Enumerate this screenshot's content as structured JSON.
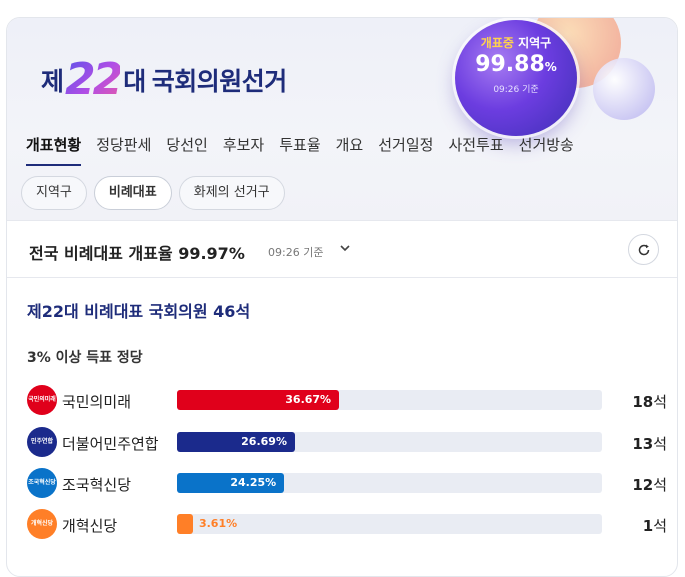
{
  "header": {
    "logo": {
      "prefix": "제",
      "number": "22",
      "suffix_dae": "대",
      "title": "국회의원선거"
    },
    "orb": {
      "label_a": "개표중",
      "label_b": "지역구",
      "percent": "99.88",
      "percent_unit": "%",
      "time": "09:26 기준"
    }
  },
  "tabs": [
    {
      "label": "개표현황",
      "active": true
    },
    {
      "label": "정당판세"
    },
    {
      "label": "당선인"
    },
    {
      "label": "후보자"
    },
    {
      "label": "투표율"
    },
    {
      "label": "개요"
    },
    {
      "label": "선거일정"
    },
    {
      "label": "사전투표"
    },
    {
      "label": "선거방송"
    }
  ],
  "pills": [
    {
      "label": "지역구"
    },
    {
      "label": "비례대표",
      "active": true
    },
    {
      "label": "화제의 선거구"
    }
  ],
  "status": {
    "text": "전국 비례대표 개표율",
    "percent": "99.97",
    "unit": "%",
    "time": "09:26 기준",
    "refresh_icon": "refresh-icon"
  },
  "main": {
    "title": "제22대 비례대표 국회의원 46석",
    "subtitle": "3% 이상 득표 정당",
    "parties": [
      {
        "name": "국민의미래",
        "icon_text": "국민의미래",
        "share": 36.67,
        "share_label": "36.67%",
        "seats": "18",
        "seat_unit": "석",
        "color": "#e0001b",
        "label_inside": true
      },
      {
        "name": "더불어민주연합",
        "icon_text": "민주연합",
        "share": 26.69,
        "share_label": "26.69%",
        "seats": "13",
        "seat_unit": "석",
        "color": "#1b2a8c",
        "label_inside": true
      },
      {
        "name": "조국혁신당",
        "icon_text": "조국혁신당",
        "share": 24.25,
        "share_label": "24.25%",
        "seats": "12",
        "seat_unit": "석",
        "color": "#0a73c9",
        "label_inside": true
      },
      {
        "name": "개혁신당",
        "icon_text": "개혁신당",
        "share": 3.61,
        "share_label": "3.61%",
        "seats": "1",
        "seat_unit": "석",
        "color": "#ff7f27",
        "label_inside": false
      }
    ]
  }
}
